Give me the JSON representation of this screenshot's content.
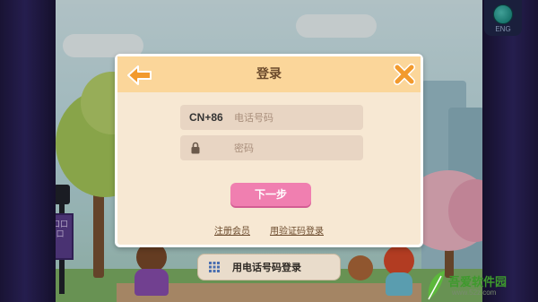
{
  "language_button": {
    "label": "ENG"
  },
  "background": {
    "banner_text": "口口口"
  },
  "dialog": {
    "title": "登录",
    "phone_field": {
      "country_code": "CN+86",
      "placeholder": "电话号码",
      "value": ""
    },
    "password_field": {
      "placeholder": "密码",
      "value": ""
    },
    "next_button": "下一步",
    "register_link": "注册会员",
    "sms_login_link": "用验证码登录"
  },
  "phone_login_button": {
    "label": "用电话号码登录"
  },
  "watermark": {
    "title": "吾爱软件园",
    "url": "www.52z.com"
  },
  "colors": {
    "header": "#fbd69a",
    "dialog_bg": "#f7e8d3",
    "accent_orange": "#f29a2e",
    "button_pink": "#f07fb0",
    "curtain": "#2e2560"
  },
  "icons": {
    "back": "back-arrow-icon",
    "close": "close-icon",
    "lock": "lock-icon",
    "grid": "grid-icon",
    "globe": "globe-icon"
  }
}
